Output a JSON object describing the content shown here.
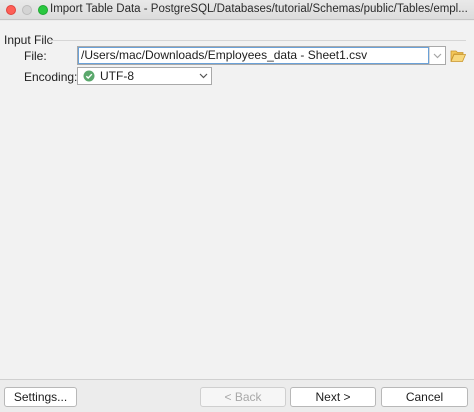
{
  "window": {
    "title": "Import Table Data - PostgreSQL/Databases/tutorial/Schemas/public/Tables/empl..."
  },
  "input_file": {
    "group_label": "Input File",
    "file_label": "File:",
    "file_value": "/Users/mac/Downloads/Employees_data - Sheet1.csv",
    "encoding_label": "Encoding:",
    "encoding_value": "UTF-8"
  },
  "buttons": {
    "settings": "Settings...",
    "back": "< Back",
    "next": "Next >",
    "cancel": "Cancel"
  },
  "icons": {
    "folder": "folder-open-icon",
    "encoding": "check-circle-icon"
  },
  "colors": {
    "window_bg": "#f2f2f2",
    "close": "#fe5f57",
    "zoom": "#2ac840",
    "focus": "#6aa1d8"
  }
}
